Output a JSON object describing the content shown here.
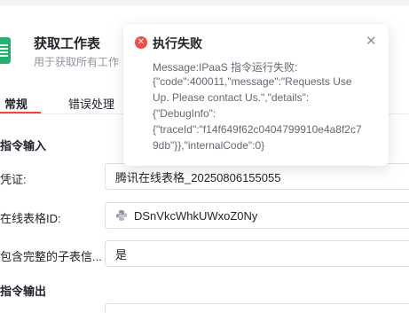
{
  "header": {
    "title": "获取工作表",
    "subtitle": "用于获取所有工作"
  },
  "tabs": [
    {
      "label": "常规",
      "active": true
    },
    {
      "label": "错误处理",
      "active": false
    }
  ],
  "sections": {
    "input_title": "指令输入",
    "output_title": "指令输出"
  },
  "fields": [
    {
      "label": "凭证:",
      "value": "腾讯在线表格_20250806155055"
    },
    {
      "label": "在线表格ID:",
      "value": "DSnVkcWhkUWxoZ0Ny",
      "icon": "python-icon"
    },
    {
      "label": "包含完整的子表信...",
      "value": "是"
    }
  ],
  "error_toast": {
    "title": "执行失败",
    "icon": "error-icon",
    "close_icon": "close-icon",
    "message_lines": [
      "Message:IPaaS 指令运行失败:",
      "{\"code\":400011,\"message\":\"Requests Use",
      "Up. Please contact Us.\",\"details\":",
      "{\"DebugInfo\":",
      "{\"traceId\":\"f14f649f62c0404799910e4a8f2c7",
      "9db\"}},\"internalCode\":0}"
    ]
  },
  "colors": {
    "accent": "#f5453b",
    "error": "#f54a45",
    "sheet_green": "#24b06f"
  }
}
